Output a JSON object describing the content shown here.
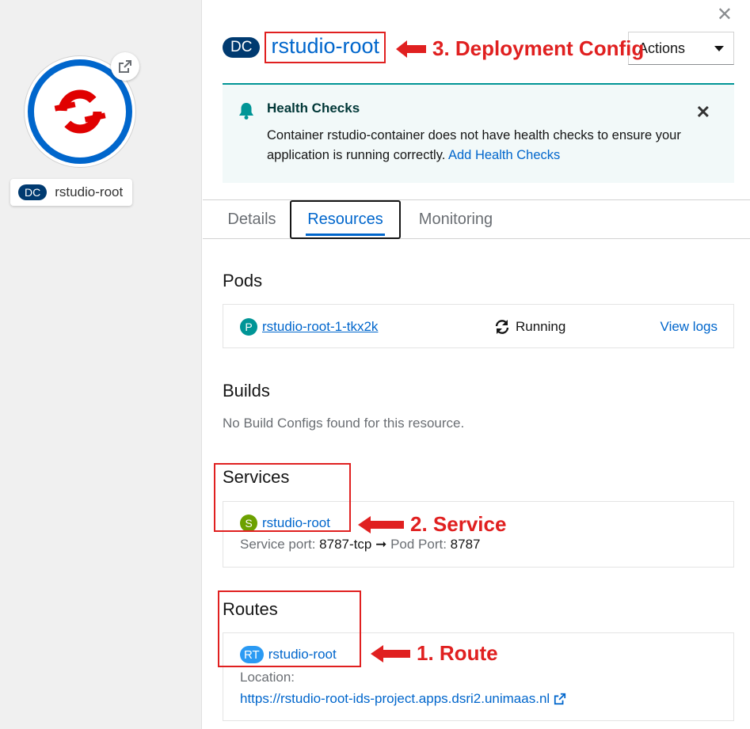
{
  "topology": {
    "node": {
      "badge": "DC",
      "label": "rstudio-root",
      "icon": "openshift-logo-icon",
      "link_icon": "external-link-icon"
    }
  },
  "panel": {
    "close_icon": "close-icon",
    "header": {
      "badge": "DC",
      "title": "rstudio-root",
      "annotation": "3. Deployment Config"
    },
    "actions": {
      "label": "Actions"
    },
    "alert": {
      "icon": "bell-icon",
      "title": "Health Checks",
      "body_line1": "Container rstudio-container does not have health checks to ensure your",
      "body_line2": "application is running correctly.",
      "link": "Add Health Checks"
    },
    "tabs": [
      {
        "label": "Details"
      },
      {
        "label": "Resources"
      },
      {
        "label": "Monitoring"
      }
    ],
    "active_tab": "Resources",
    "pods": {
      "title": "Pods",
      "badge": "P",
      "name": "rstudio-root-1-tkx2k",
      "status": "Running",
      "view_logs": "View logs"
    },
    "builds": {
      "title": "Builds",
      "empty": "No Build Configs found for this resource."
    },
    "services": {
      "title": "Services",
      "badge": "S",
      "name": "rstudio-root",
      "port_label": "Service port:",
      "port_value": "8787-tcp",
      "arrow": "➞",
      "pod_port_label": "Pod Port:",
      "pod_port_value": "8787",
      "annotation": "2. Service"
    },
    "routes": {
      "title": "Routes",
      "badge": "RT",
      "name": "rstudio-root",
      "location_label": "Location:",
      "location_url": "https://rstudio-root-ids-project.apps.dsri2.unimaas.nl",
      "annotation": "1. Route"
    }
  },
  "colors": {
    "link": "#0066cc",
    "dc_badge": "#003a70",
    "pod_badge": "#009596",
    "service_badge": "#6ca100",
    "route_badge": "#2b9af3",
    "annotation": "#e02020",
    "alert_bg": "#f2f9f9"
  }
}
